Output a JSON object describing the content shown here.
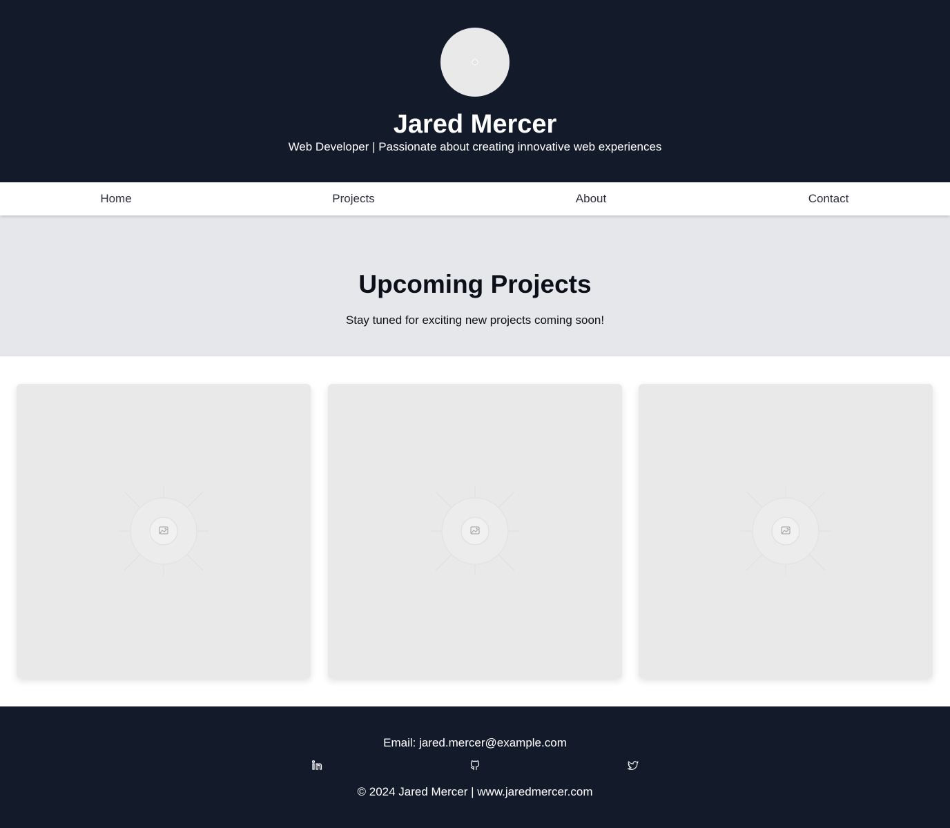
{
  "header": {
    "avatar_icon": "image-placeholder-icon",
    "name": "Jared Mercer",
    "tagline": "Web Developer | Passionate about creating innovative web experiences"
  },
  "nav": {
    "items": [
      {
        "label": "Home"
      },
      {
        "label": "Projects"
      },
      {
        "label": "About"
      },
      {
        "label": "Contact"
      }
    ]
  },
  "hero": {
    "title": "Upcoming Projects",
    "subtitle": "Stay tuned for exciting new projects coming soon!"
  },
  "projects": {
    "cards": [
      {
        "icon": "image-placeholder-icon"
      },
      {
        "icon": "image-placeholder-icon"
      },
      {
        "icon": "image-placeholder-icon"
      }
    ]
  },
  "footer": {
    "email": "Email: jared.mercer@example.com",
    "social": [
      {
        "icon": "linkedin-icon"
      },
      {
        "icon": "github-icon"
      },
      {
        "icon": "twitter-icon"
      }
    ],
    "copyright": "© 2024 Jared Mercer | www.jaredmercer.com"
  },
  "colors": {
    "header_bg": "#131a2a",
    "hero_bg": "#e5e7eb",
    "placeholder_bg": "#e9e9e9"
  }
}
